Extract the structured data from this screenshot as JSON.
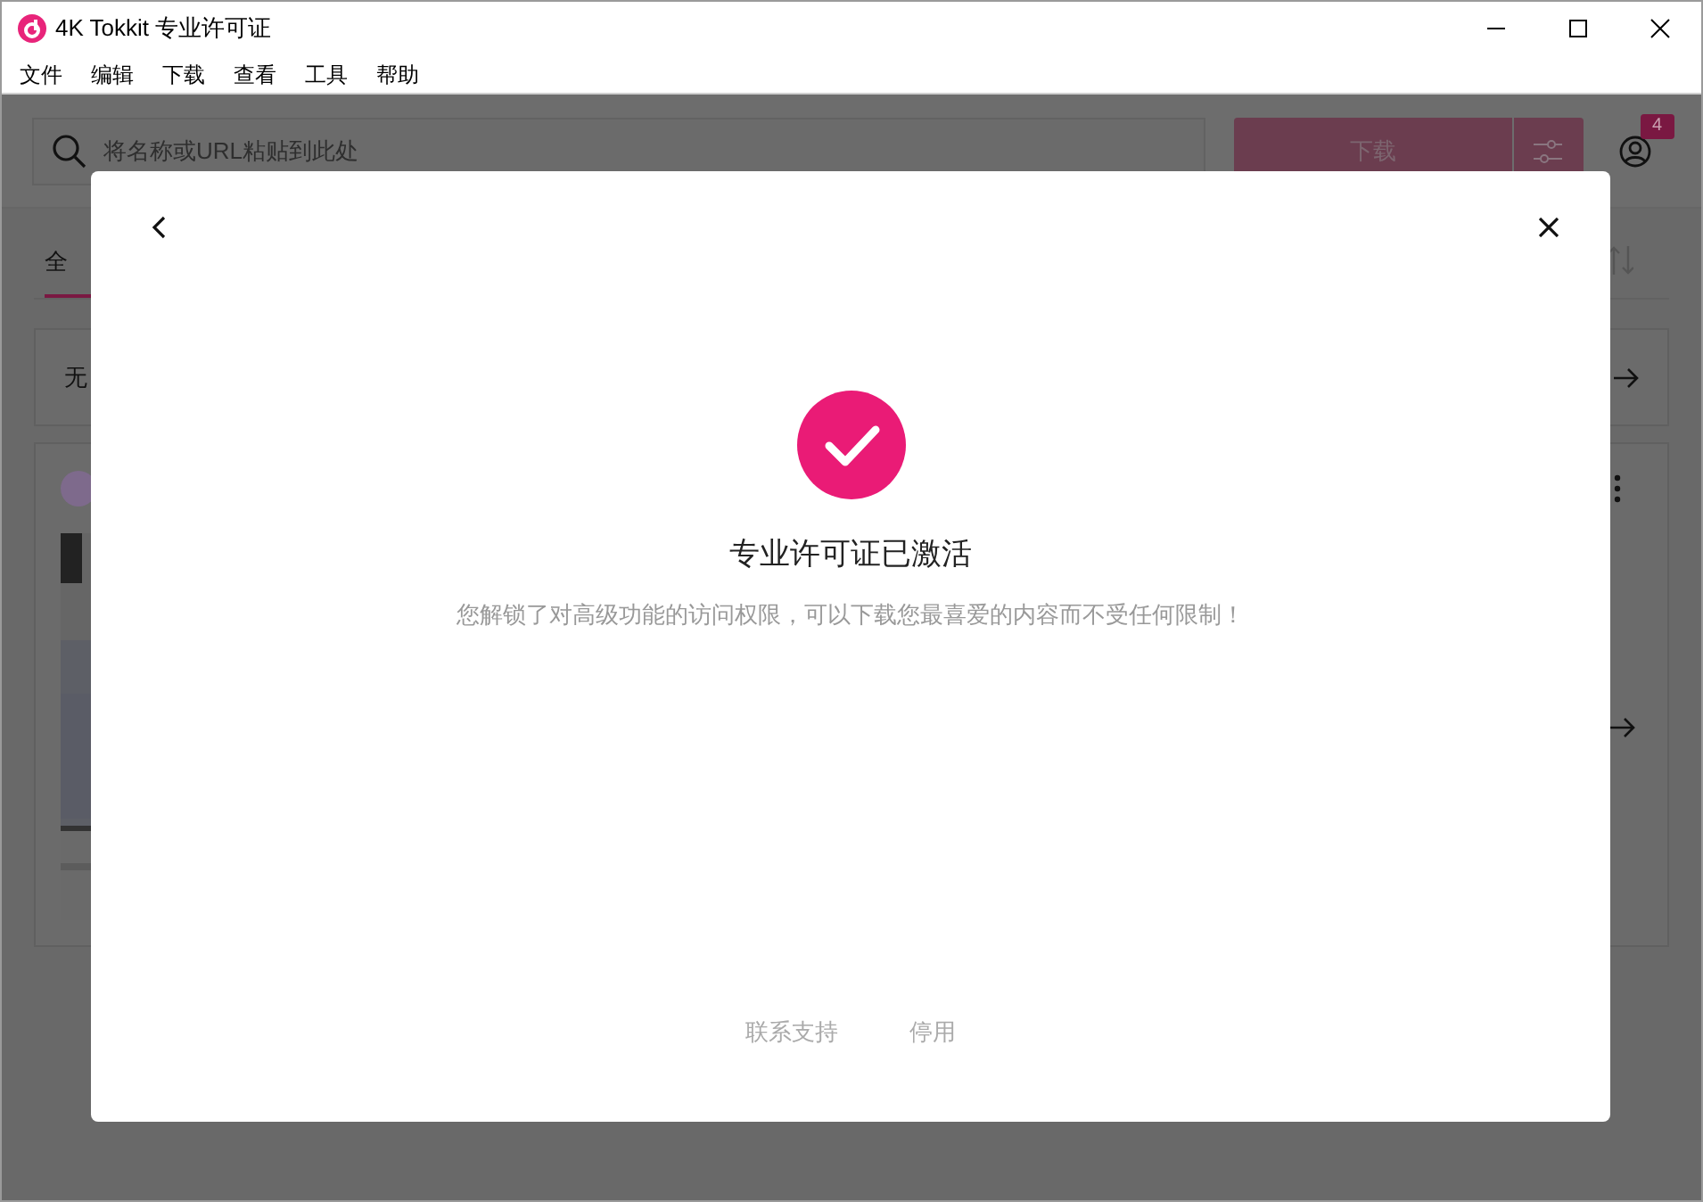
{
  "window": {
    "title": "4K Tokkit 专业许可证"
  },
  "menu": [
    "文件",
    "编辑",
    "下载",
    "查看",
    "工具",
    "帮助"
  ],
  "toolbar": {
    "search": {
      "placeholder": "将名称或URL粘贴到此处"
    },
    "download_button": "下载",
    "badge": "4"
  },
  "tabs": [
    {
      "label": "全",
      "selected": true
    }
  ],
  "cards": [
    {
      "kind": "notice",
      "text": "无"
    },
    {
      "kind": "media"
    }
  ],
  "dialog": {
    "title": "专业许可证已激活",
    "message": "您解锁了对高级功能的访问权限，可以下载您最喜爱的内容而不受任何限制！",
    "buttons": [
      "联系支持",
      "停用"
    ]
  }
}
